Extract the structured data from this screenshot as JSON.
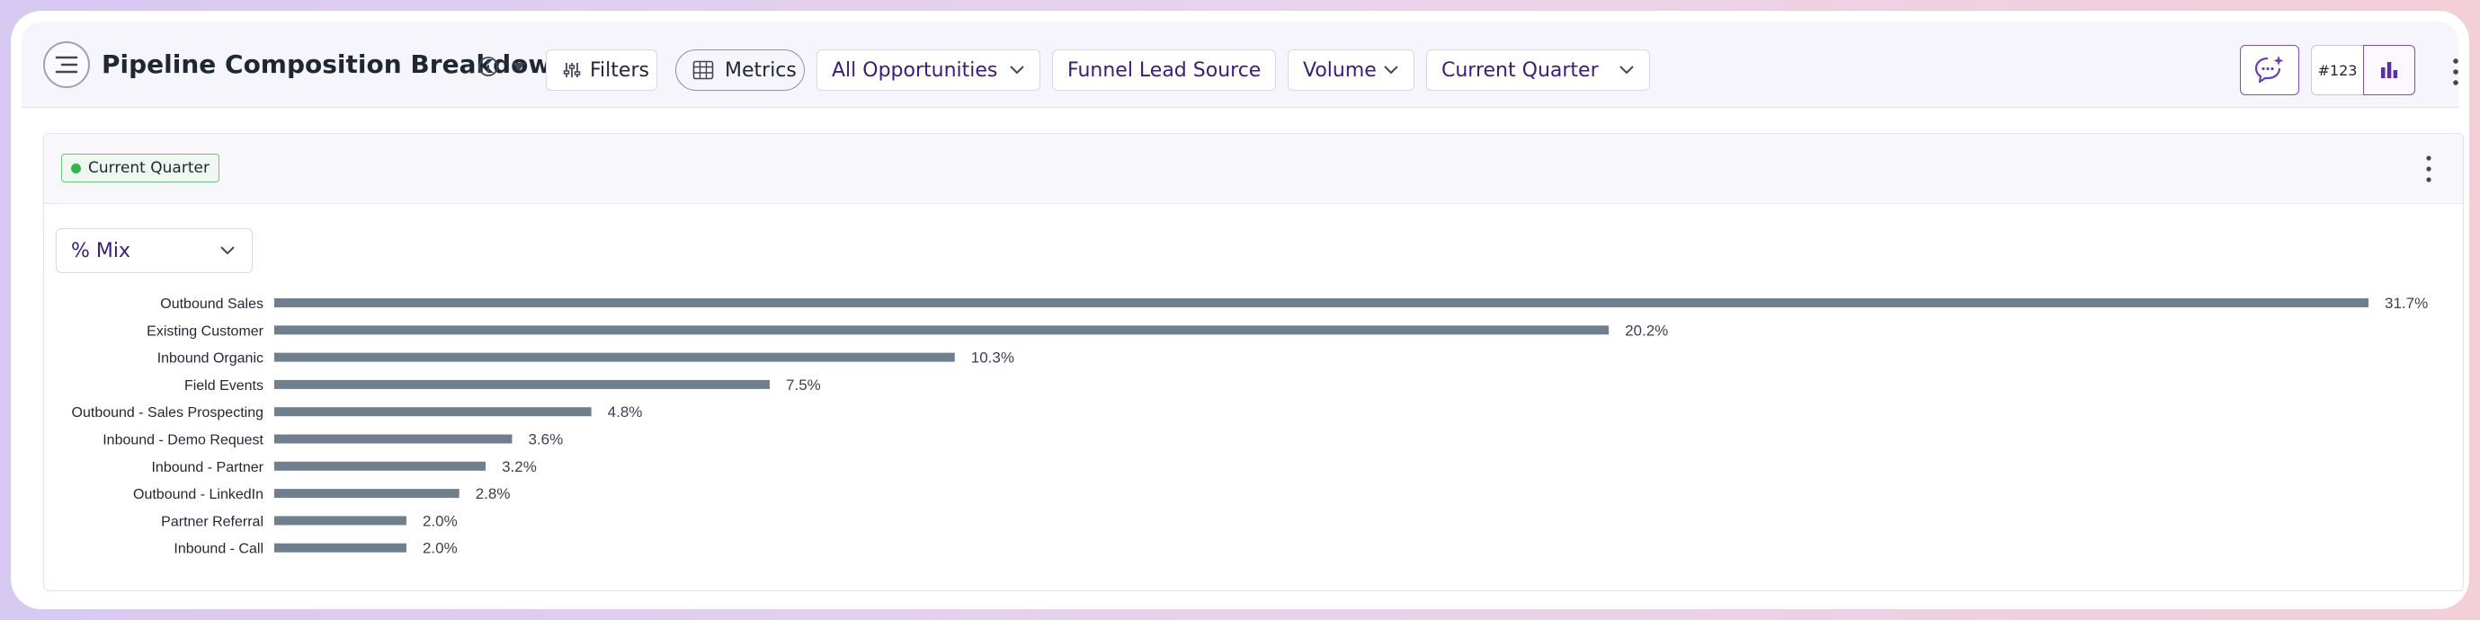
{
  "header": {
    "title": "Pipeline Composition Breakdown",
    "filters_label": "Filters",
    "metrics_label": "Metrics",
    "dropdowns": [
      {
        "value": "All Opportunities"
      },
      {
        "value": "Funnel Lead Source"
      },
      {
        "value": "Volume"
      },
      {
        "value": "Current Quarter"
      }
    ],
    "number_format_label": "#123"
  },
  "card": {
    "badge_label": "Current Quarter",
    "mix_select_value": "% Mix"
  },
  "colors": {
    "bar": "#6f7f8d",
    "accent": "#7b4fc0",
    "badge_dot": "#37b24d"
  },
  "chart_data": {
    "type": "bar",
    "orientation": "horizontal",
    "categories": [
      "Outbound Sales",
      "Existing Customer",
      "Inbound Organic",
      "Field Events",
      "Outbound - Sales Prospecting",
      "Inbound - Demo Request",
      "Inbound - Partner",
      "Outbound - LinkedIn",
      "Partner Referral",
      "Inbound - Call"
    ],
    "values": [
      31.7,
      20.2,
      10.3,
      7.5,
      4.8,
      3.6,
      3.2,
      2.8,
      2.0,
      2.0
    ],
    "data_labels": [
      "31.7%",
      "20.2%",
      "10.3%",
      "7.5%",
      "4.8%",
      "3.6%",
      "3.2%",
      "2.8%",
      "2.0%",
      "2.0%"
    ],
    "value_unit": "%",
    "xlim": [
      0,
      31.7
    ],
    "grid": false,
    "legend": "none"
  }
}
